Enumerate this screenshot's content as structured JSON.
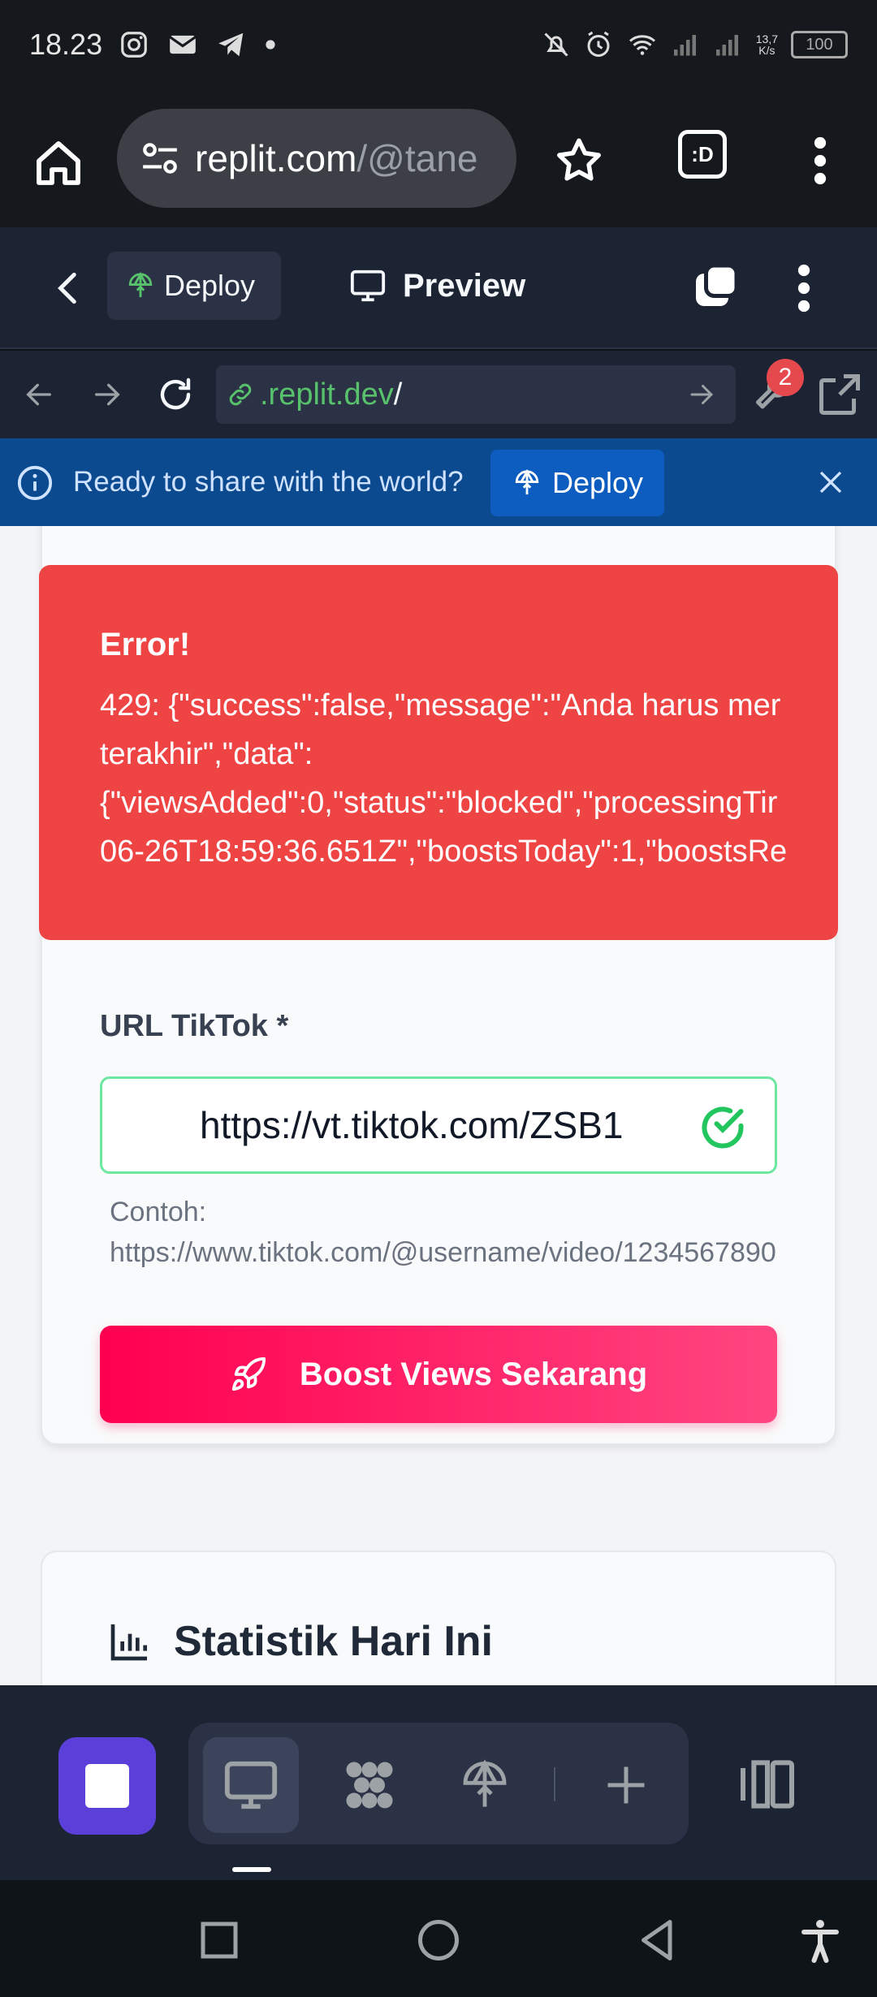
{
  "status_bar": {
    "time": "18.23",
    "net_speed_top": "13,7",
    "net_speed_bottom": "K/s",
    "battery": "100"
  },
  "browser": {
    "url_host": "replit.com",
    "url_path": "/@tane",
    "tab_count": ":D"
  },
  "replit_header": {
    "deploy_tab_label": "Deploy",
    "preview_tab_label": "Preview"
  },
  "webview": {
    "url_host": ".replit.dev",
    "url_path": "/",
    "tools_badge": "2"
  },
  "banner": {
    "message": "Ready to share with the world?",
    "deploy_label": "Deploy"
  },
  "error": {
    "title": "Error!",
    "lines": [
      "429: {\"success\":false,\"message\":\"Anda harus mer",
      "terakhir\",\"data\":",
      "{\"viewsAdded\":0,\"status\":\"blocked\",\"processingTir",
      "06-26T18:59:36.651Z\",\"boostsToday\":1,\"boostsRe"
    ]
  },
  "form": {
    "url_label": "URL TikTok *",
    "url_value": "https://vt.tiktok.com/ZSB1",
    "hint_line1": "Contoh:",
    "hint_line2": "https://www.tiktok.com/@username/video/1234567890",
    "boost_label": "Boost Views Sekarang"
  },
  "stats": {
    "title": "Statistik Hari Ini"
  },
  "colors": {
    "error_bg": "#ef4444",
    "boost_start": "#ff0050",
    "boost_end": "#ff4680",
    "banner_bg": "#0b4a8f",
    "replit_bg": "#1c2333",
    "input_border_valid": "#6ee7a0",
    "app_button": "#5a3fd9"
  }
}
